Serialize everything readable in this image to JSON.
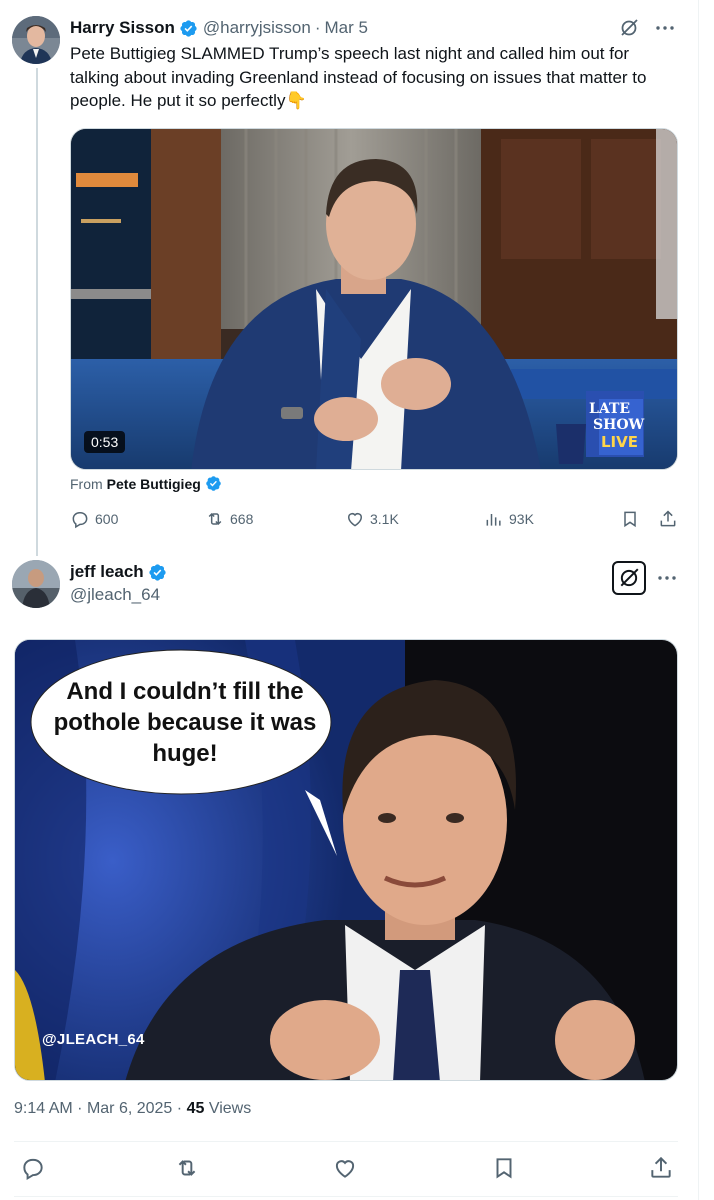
{
  "tweet1": {
    "author_name": "Harry Sisson",
    "handle": "@harryjsisson",
    "separator": "·",
    "date": "Mar 5",
    "text": "Pete Buttigieg SLAMMED Trump’s speech last night and called him out for talking about invading Greenland instead of focusing on issues that matter to people. He put it so perfectly👇",
    "video_duration": "0:53",
    "video_logo_lines": [
      "LATE",
      "SHOW",
      "LIVE"
    ],
    "from_prefix": "From",
    "from_name": "Pete Buttigieg",
    "replies": "600",
    "reposts": "668",
    "likes": "3.1K",
    "views": "93K"
  },
  "tweet2": {
    "author_name": "jeff leach",
    "handle": "@jleach_64",
    "bubble_text": "And I couldn’t fill the pothole because it was huge!",
    "watermark": "@JLEACH_64",
    "time": "9:14 AM",
    "separator": "·",
    "date": "Mar 6, 2025",
    "views_count": "45",
    "views_label": "Views"
  },
  "colors": {
    "verified": "#1d9bf0",
    "secondary_text": "#536471",
    "primary_text": "#0f1419",
    "border": "#cfd9de"
  },
  "icons": {
    "grok": "grok-icon",
    "more": "more-icon",
    "reply": "reply-icon",
    "repost": "repost-icon",
    "like": "like-icon",
    "views": "views-icon",
    "bookmark": "bookmark-icon",
    "share": "share-icon",
    "verified": "verified-badge-icon"
  }
}
